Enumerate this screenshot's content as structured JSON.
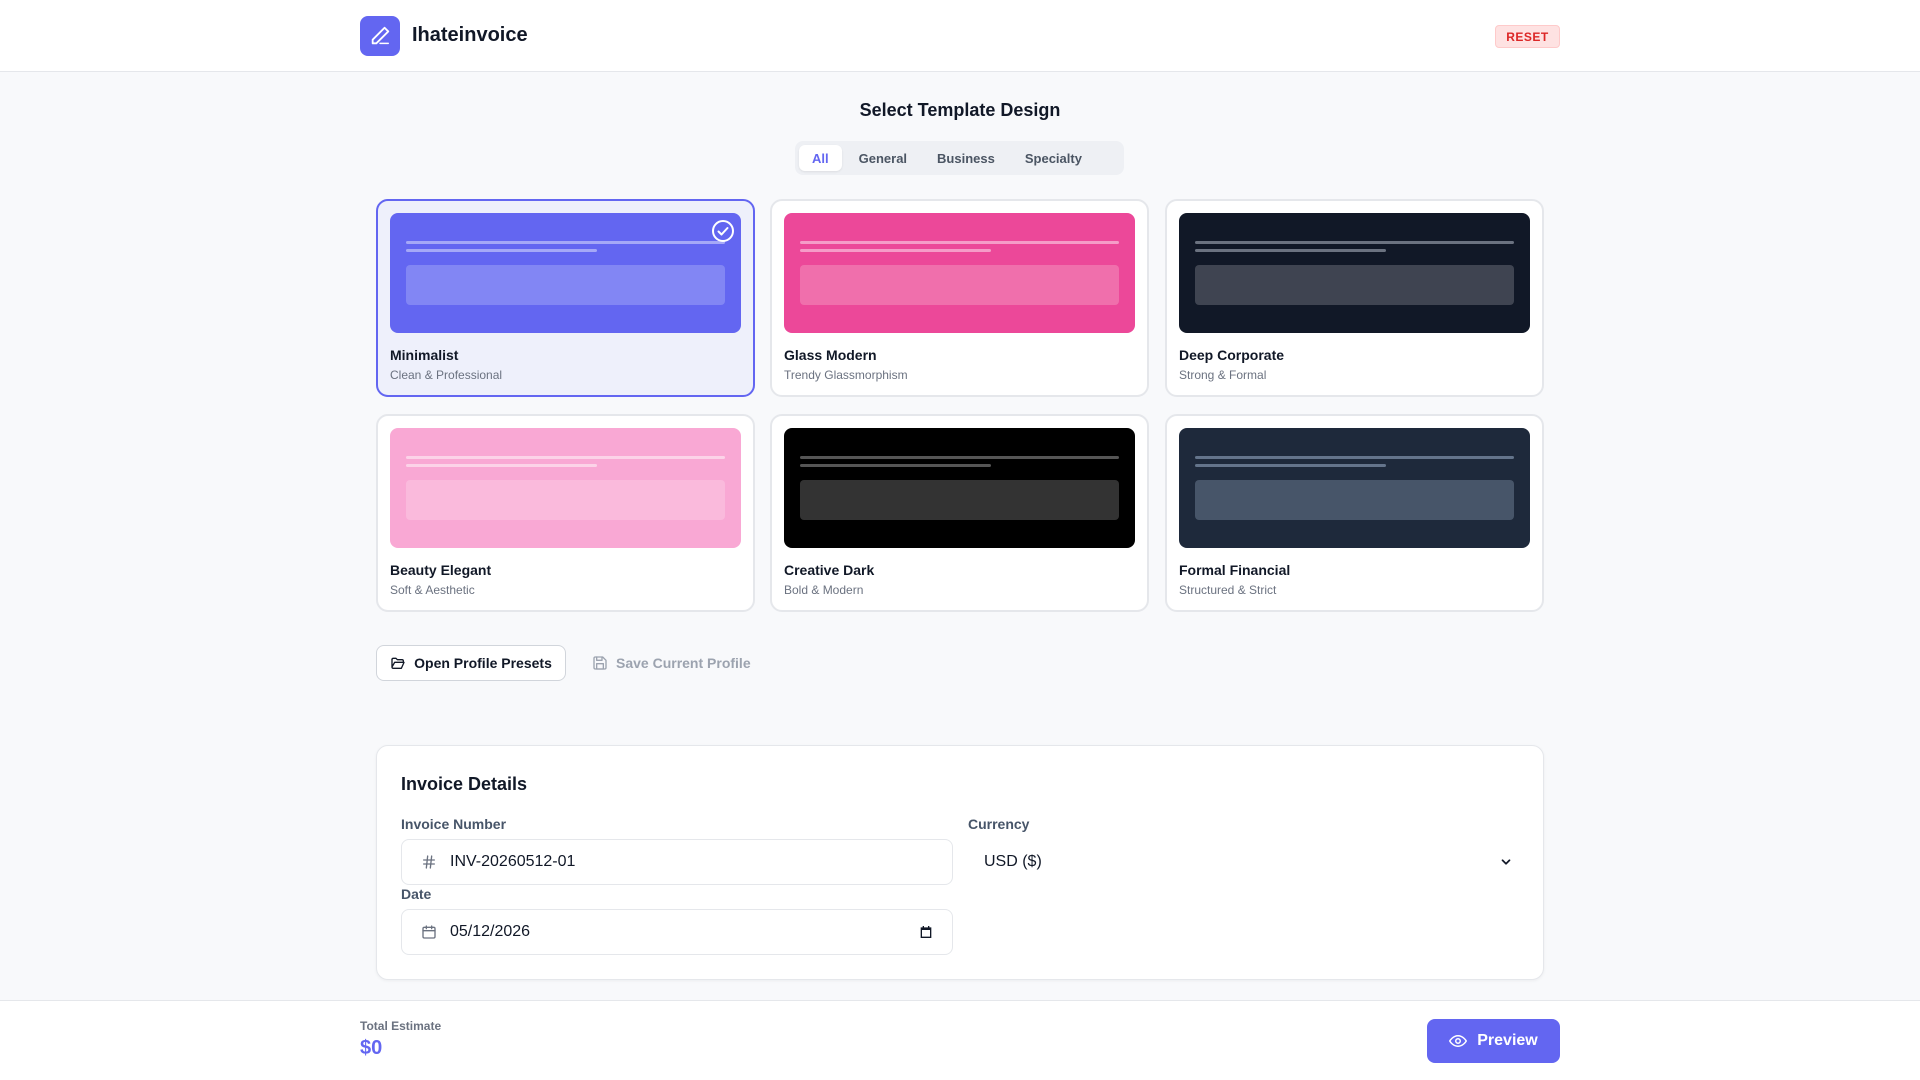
{
  "app": {
    "brand": "Ihateinvoice",
    "logo_icon": "pen-icon"
  },
  "header": {
    "reset_label": "RESET"
  },
  "templates": {
    "section_title": "Select Template Design",
    "tabs": [
      {
        "label": "All",
        "active": true
      },
      {
        "label": "General",
        "active": false
      },
      {
        "label": "Business",
        "active": false
      },
      {
        "label": "Specialty",
        "active": false
      }
    ],
    "cards": [
      {
        "name": "Minimalist",
        "subtitle": "Clean & Professional",
        "selected": true,
        "thumb_bg": "#6366f1",
        "line_color": "#a5a8f7",
        "block_color": "#8286f4"
      },
      {
        "name": "Glass Modern",
        "subtitle": "Trendy Glassmorphism",
        "selected": false,
        "thumb_bg": "#ec4899",
        "line_color": "#f59cc8",
        "block_color": "#f06fac"
      },
      {
        "name": "Deep Corporate",
        "subtitle": "Strong & Formal",
        "selected": false,
        "thumb_bg": "#111827",
        "line_color": "#6b7280",
        "block_color": "#3f4451"
      },
      {
        "name": "Beauty Elegant",
        "subtitle": "Soft & Aesthetic",
        "selected": false,
        "thumb_bg": "#f9a8d4",
        "line_color": "#fcd3e8",
        "block_color": "#fabadc"
      },
      {
        "name": "Creative Dark",
        "subtitle": "Bold & Modern",
        "selected": false,
        "thumb_bg": "#000000",
        "line_color": "#555555",
        "block_color": "#333333"
      },
      {
        "name": "Formal Financial",
        "subtitle": "Structured & Strict",
        "selected": false,
        "thumb_bg": "#1e293b",
        "line_color": "#64748b",
        "block_color": "#475569"
      }
    ]
  },
  "profile_actions": {
    "open_label": "Open Profile Presets",
    "save_label": "Save Current Profile"
  },
  "invoice_details": {
    "title": "Invoice Details",
    "invoice_number_label": "Invoice Number",
    "invoice_number_value": "INV-20260512-01",
    "currency_label": "Currency",
    "currency_value": "USD ($)",
    "date_label": "Date",
    "date_value": "05/12/2026"
  },
  "footer": {
    "total_label": "Total Estimate",
    "total_value": "$0",
    "preview_label": "Preview"
  },
  "colors": {
    "accent": "#6366f1",
    "danger": "#dc2626"
  }
}
